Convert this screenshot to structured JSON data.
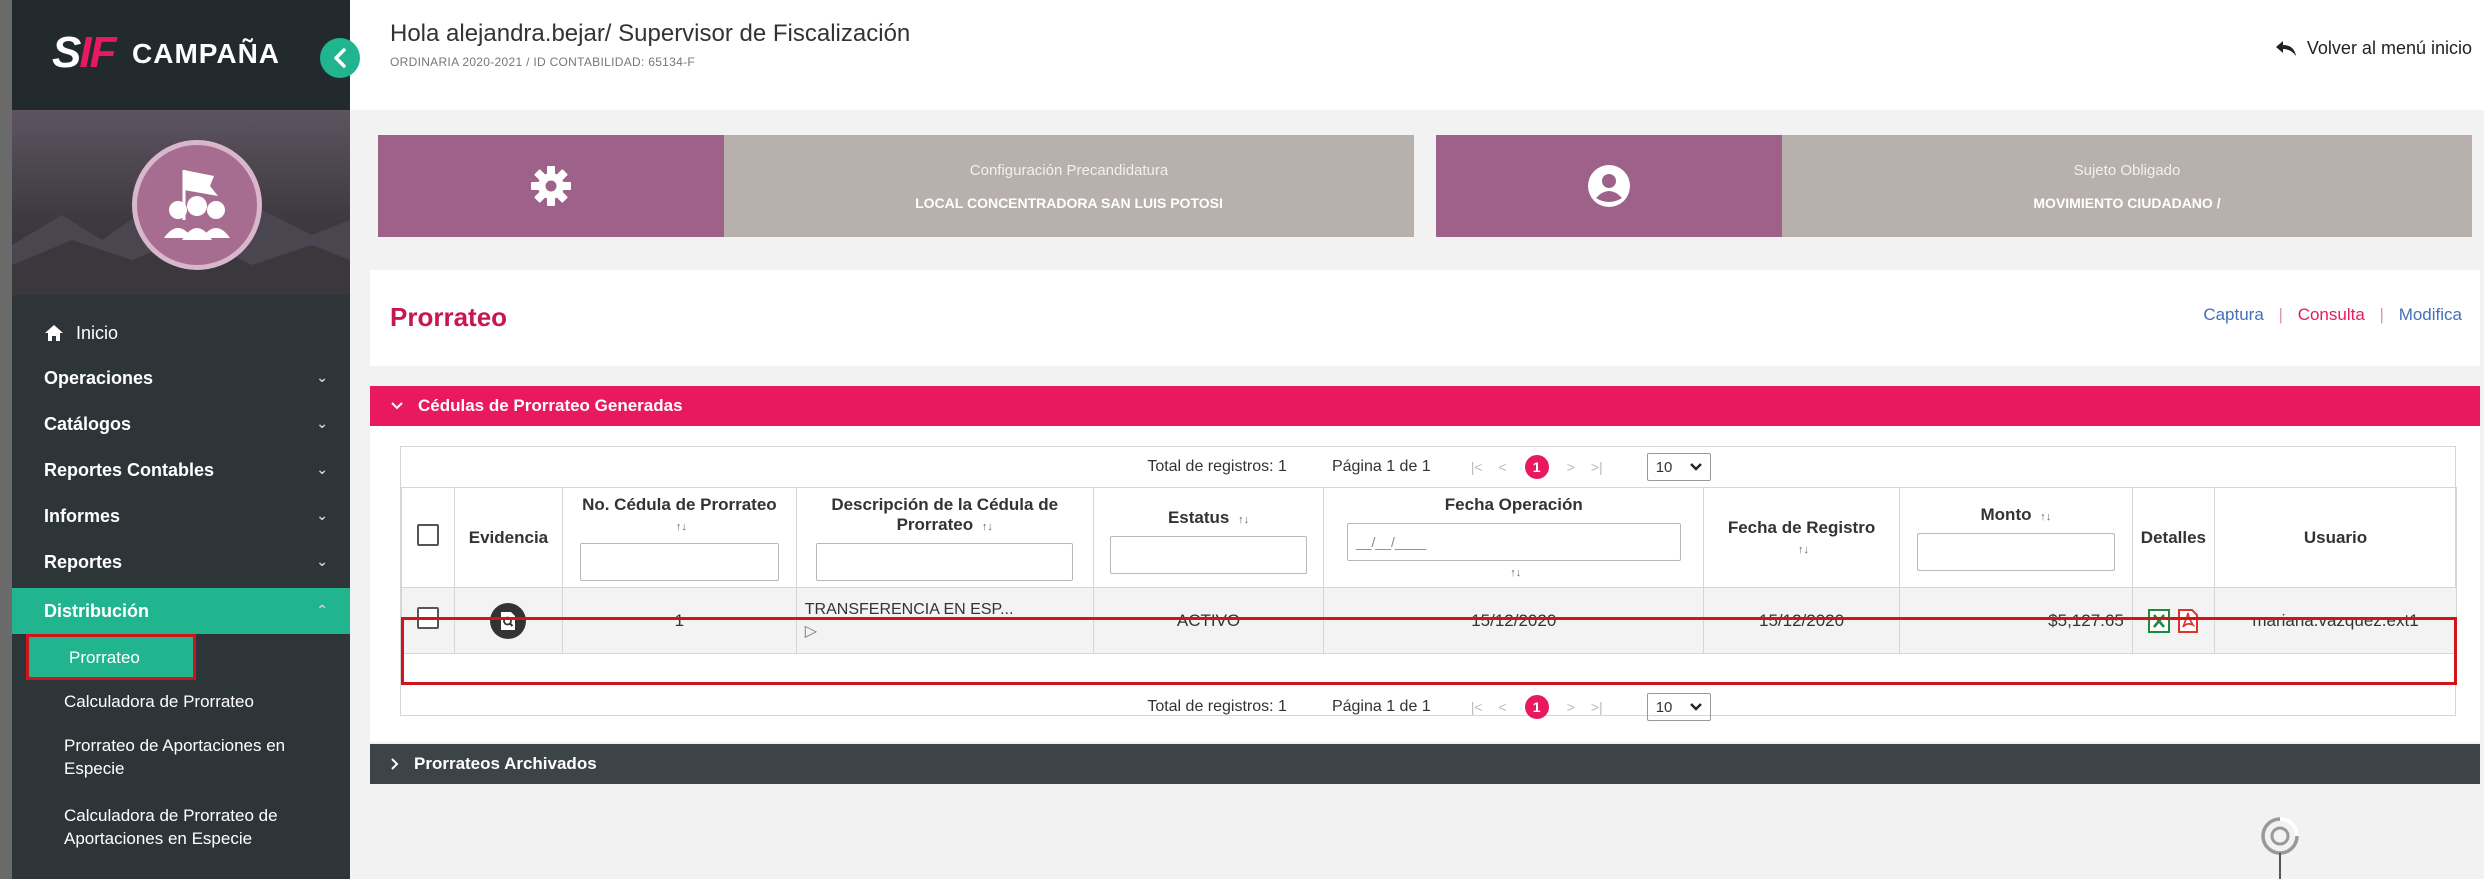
{
  "sidebar": {
    "logo_mark": "SIF",
    "logo_text": "CAMPAÑA",
    "items": [
      {
        "label": "Inicio"
      },
      {
        "label": "Operaciones"
      },
      {
        "label": "Catálogos"
      },
      {
        "label": "Reportes Contables"
      },
      {
        "label": "Informes"
      },
      {
        "label": "Reportes"
      },
      {
        "label": "Distribución"
      }
    ],
    "subitems": [
      {
        "label": "Prorrateo"
      },
      {
        "label": "Calculadora de Prorrateo"
      },
      {
        "label": "Prorrateo de Aportaciones en Especie"
      },
      {
        "label": "Calculadora de Prorrateo de Aportaciones en Especie"
      }
    ]
  },
  "header": {
    "greeting": "Hola alejandra.bejar/ Supervisor de Fiscalización",
    "cycle": "ORDINARIA 2020-2021 / ID CONTABILIDAD: 65134-F",
    "back_label": "Volver al menú inicio"
  },
  "cards": {
    "config": {
      "title": "Configuración Precandidatura",
      "value": "LOCAL CONCENTRADORA SAN LUIS POTOSI"
    },
    "subject": {
      "title": "Sujeto Obligado",
      "value": "MOVIMIENTO CIUDADANO /"
    }
  },
  "page": {
    "title": "Prorrateo",
    "links": {
      "captura": "Captura",
      "consulta": "Consulta",
      "modifica": "Modifica"
    },
    "separator": "|"
  },
  "panel": {
    "title": "Cédulas de Prorrateo Generadas",
    "archived_title": "Prorrateos Archivados"
  },
  "pager": {
    "total": "Total de registros: 1",
    "page": "Página 1 de 1",
    "current": "1",
    "per_page": "10"
  },
  "table": {
    "headers": {
      "evidencia": "Evidencia",
      "no_cedula": "No. Cédula de Prorrateo",
      "descripcion": "Descripción de la Cédula de Prorrateo",
      "estatus": "Estatus",
      "fecha_operacion": "Fecha Operación",
      "fecha_registro": "Fecha de Registro",
      "monto": "Monto",
      "detalles": "Detalles",
      "usuario": "Usuario"
    },
    "date_placeholder": "__/__/____",
    "rows": [
      {
        "no_cedula": "1",
        "descripcion": "TRANSFERENCIA EN ESP...",
        "estatus": "ACTIVO",
        "fecha_operacion": "15/12/2020",
        "fecha_registro": "15/12/2020",
        "monto": "$5,127.65",
        "usuario": "mariana.vazquez.ext1"
      }
    ]
  },
  "colors": {
    "accent_pink": "#e8195f",
    "sidebar_bg": "#2e3538",
    "active_green": "#20b58f",
    "card_purple": "#9e628a",
    "card_gray": "#b8b0ac"
  }
}
